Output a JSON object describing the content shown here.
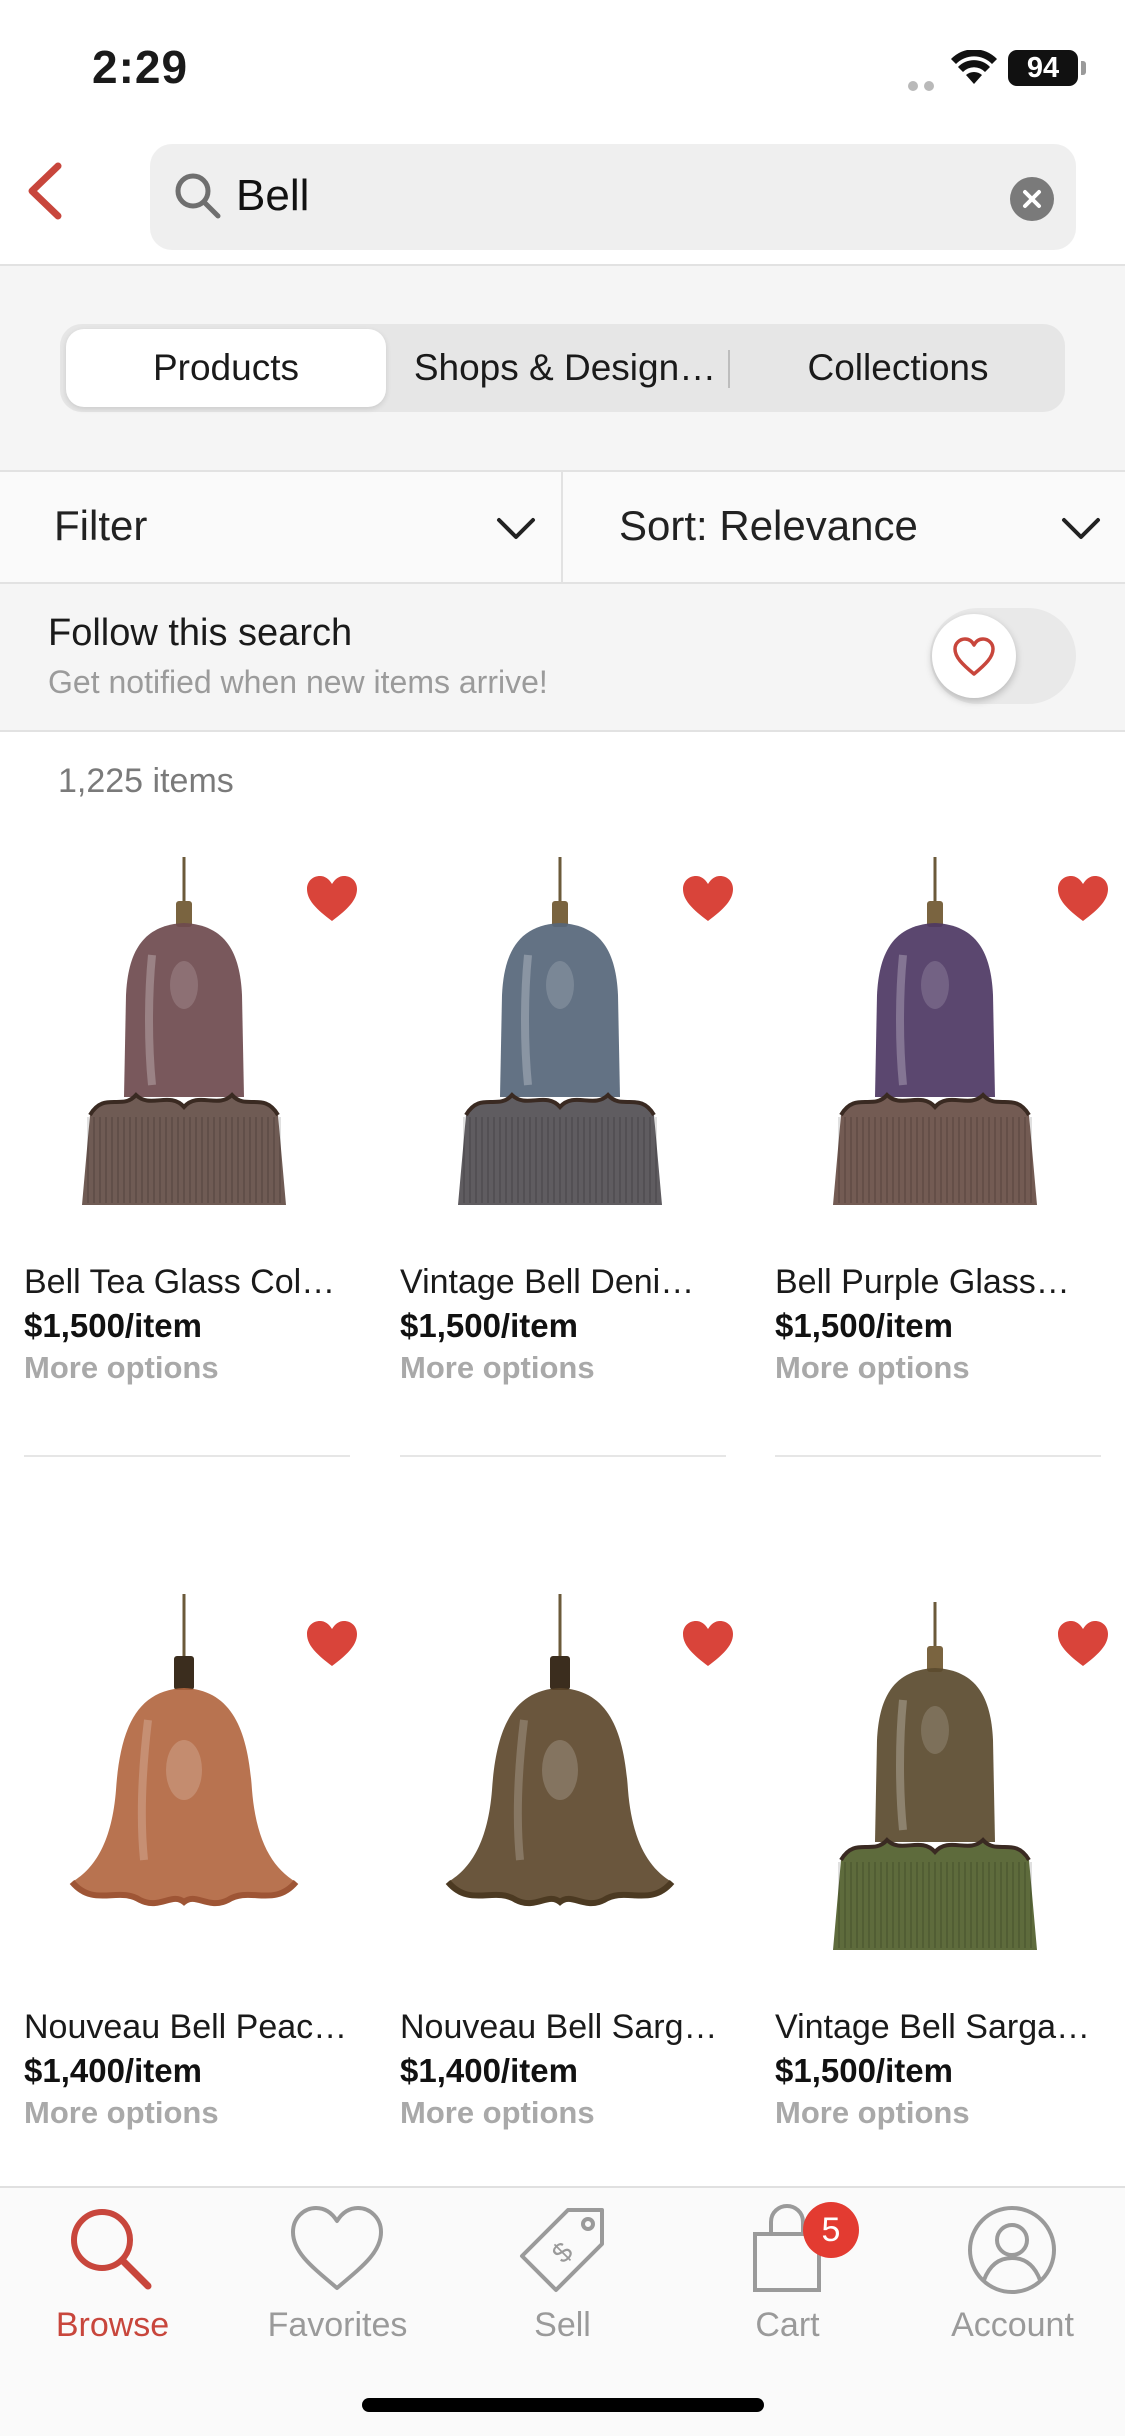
{
  "status_bar": {
    "time": "2:29",
    "battery": "94"
  },
  "search": {
    "query": "Bell"
  },
  "tabs": [
    {
      "label": "Products",
      "active": true
    },
    {
      "label": "Shops & Design…",
      "active": false
    },
    {
      "label": "Collections",
      "active": false
    }
  ],
  "filter": {
    "label": "Filter"
  },
  "sort": {
    "label": "Sort: Relevance"
  },
  "follow": {
    "title": "Follow this search",
    "subtitle": "Get notified when new items arrive!"
  },
  "results": {
    "count": "1,225 items"
  },
  "products": [
    {
      "name": "Bell Tea Glass Col…",
      "price": "$1,500/item",
      "options": "More options",
      "glass_color": "#6e4a4e",
      "fringe_color": "#6f5b54",
      "shape": "tall-fringe"
    },
    {
      "name": "Vintage Bell Deni…",
      "price": "$1,500/item",
      "options": "More options",
      "glass_color": "#56667a",
      "fringe_color": "#5f5c60",
      "shape": "tall-fringe"
    },
    {
      "name": "Bell Purple Glass…",
      "price": "$1,500/item",
      "options": "More options",
      "glass_color": "#4d3763",
      "fringe_color": "#735b53",
      "shape": "tall-fringe"
    },
    {
      "name": "Nouveau Bell Peac…",
      "price": "$1,400/item",
      "options": "More options",
      "glass_color": "#b0643d",
      "fringe_color": "#9e5535",
      "shape": "bell-flare"
    },
    {
      "name": "Nouveau Bell Sarg…",
      "price": "$1,400/item",
      "options": "More options",
      "glass_color": "#5a4428",
      "fringe_color": "#4c3a22",
      "shape": "bell-flare"
    },
    {
      "name": "Vintage Bell Sarga…",
      "price": "$1,500/item",
      "options": "More options",
      "glass_color": "#5a4a2e",
      "fringe_color": "#5e6b3c",
      "shape": "tall-fringe"
    }
  ],
  "nav": [
    {
      "label": "Browse",
      "icon": "search-icon",
      "active": true
    },
    {
      "label": "Favorites",
      "icon": "heart-icon",
      "active": false
    },
    {
      "label": "Sell",
      "icon": "tag-icon",
      "active": false
    },
    {
      "label": "Cart",
      "icon": "cart-icon",
      "active": false,
      "badge": "5"
    },
    {
      "label": "Account",
      "icon": "user-icon",
      "active": false
    }
  ],
  "colors": {
    "accent": "#c8463c",
    "favorite": "#d9443a",
    "badge": "#e33b31"
  }
}
